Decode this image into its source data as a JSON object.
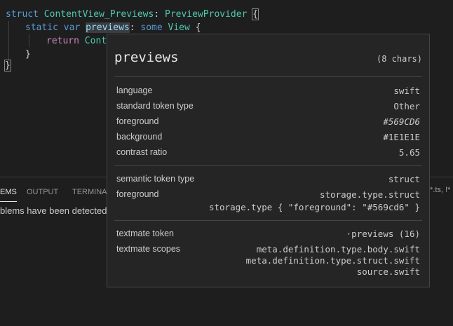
{
  "editor": {
    "line1": {
      "kw": "struct",
      "name": "ContentView_Previews",
      "colon": ": ",
      "proto": "PreviewProvider",
      "brace": "{"
    },
    "line2": {
      "kw1": "static",
      "kw2": "var",
      "name": "previews",
      "rest_colon": ": ",
      "kw3": "some",
      "type": "View",
      "brace": " {"
    },
    "line3": {
      "kw": "return",
      "rest": "Conte"
    },
    "line4": {
      "brace": "}"
    },
    "line5": {
      "brace": "}"
    }
  },
  "panel": {
    "tabs": [
      {
        "label": "EMS",
        "active": true
      },
      {
        "label": "OUTPUT",
        "active": false
      },
      {
        "label": "TERMINAL",
        "active": false
      }
    ],
    "problems_message": "blems have been detected",
    "filter_text": "*.ts, !*"
  },
  "hover": {
    "title": "previews",
    "chars": "(8 chars)",
    "rows_main": [
      {
        "key": "language",
        "value": "swift"
      },
      {
        "key": "standard token type",
        "value": "Other"
      },
      {
        "key": "foreground",
        "value": "#569CD6"
      },
      {
        "key": "background",
        "value": "#1E1E1E"
      },
      {
        "key": "contrast ratio",
        "value": "5.65"
      }
    ],
    "semantic": {
      "type_key": "semantic token type",
      "type_value": "struct",
      "fg_key": "foreground",
      "fg_value_1": "storage.type.struct",
      "fg_value_2": "storage.type { \"foreground\": \"#569cd6\" }"
    },
    "textmate": {
      "token_key": "textmate token",
      "token_value": "·previews (16)",
      "scopes_key": "textmate scopes",
      "scopes": [
        "meta.definition.type.body.swift",
        "meta.definition.type.struct.swift",
        "source.swift"
      ]
    }
  },
  "colors": {
    "keyword": "#569cd6",
    "type": "#4ec9b0",
    "identifier": "#9cdcfe",
    "background": "#1e1e1e",
    "hover_bg": "#252526"
  }
}
